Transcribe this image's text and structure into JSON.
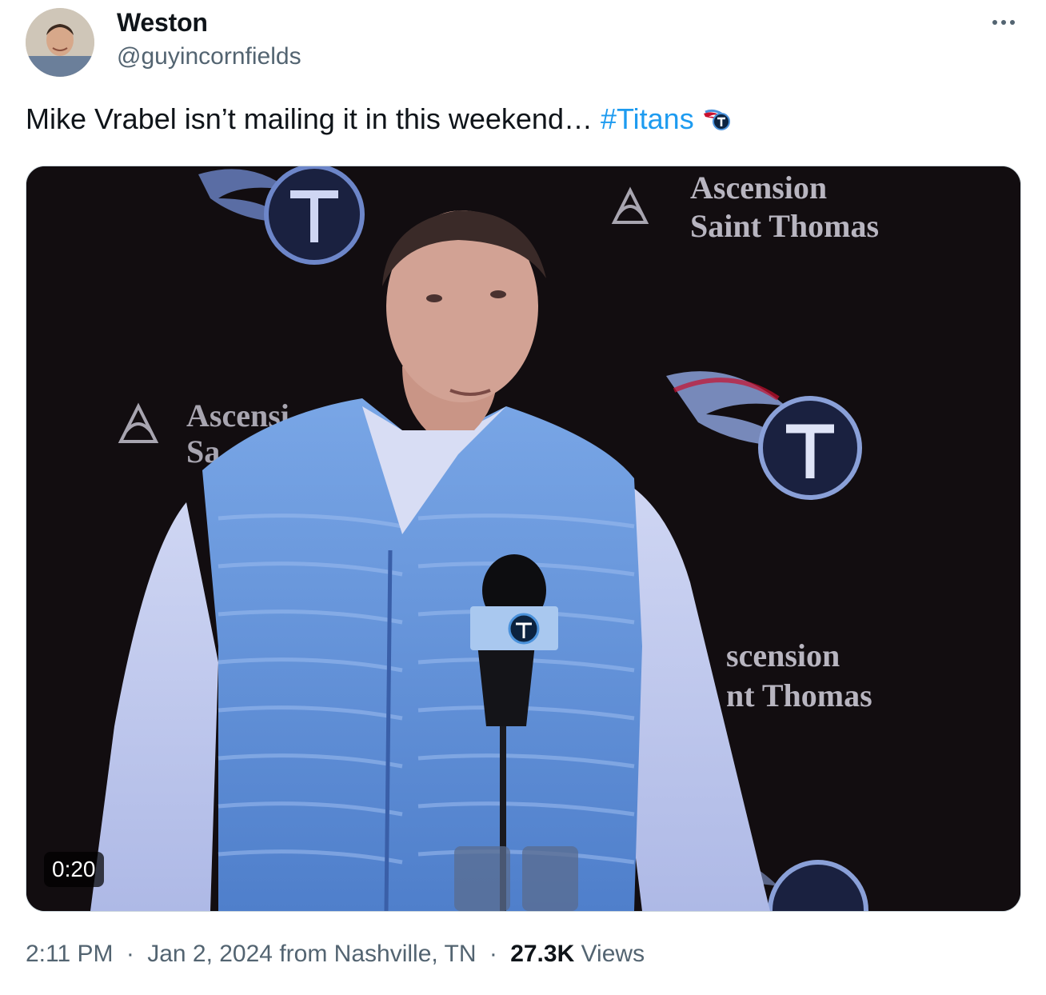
{
  "author": {
    "display_name": "Weston",
    "handle": "@guyincornfields",
    "avatar_icon": "profile-photo"
  },
  "more_icon": "ellipsis-icon",
  "tweet": {
    "text": "Mike Vrabel isn’t mailing it in this weekend… ",
    "hashtag": "#Titans",
    "emoji_icon": "titans-logo-emoji"
  },
  "media": {
    "duration": "0:20",
    "backdrop_text": {
      "sponsor_line1": "Ascension",
      "sponsor_line2": "Saint Thomas",
      "sponsor_partial_line1": "Ascensi",
      "sponsor_partial_line2": "Sa",
      "sponsor_right_line1": "scension",
      "sponsor_right_line2": "nt Thomas"
    }
  },
  "footer": {
    "time": "2:11 PM",
    "date": "Jan 2, 2024",
    "location": "from Nashville, TN",
    "views_count": "27.3K",
    "views_label": "Views",
    "separator": "·"
  },
  "colors": {
    "link": "#1d9bf0",
    "secondary_text": "#536471",
    "primary_text": "#0f1419",
    "vest": "#5b8fd6",
    "backdrop": "#120d10"
  }
}
